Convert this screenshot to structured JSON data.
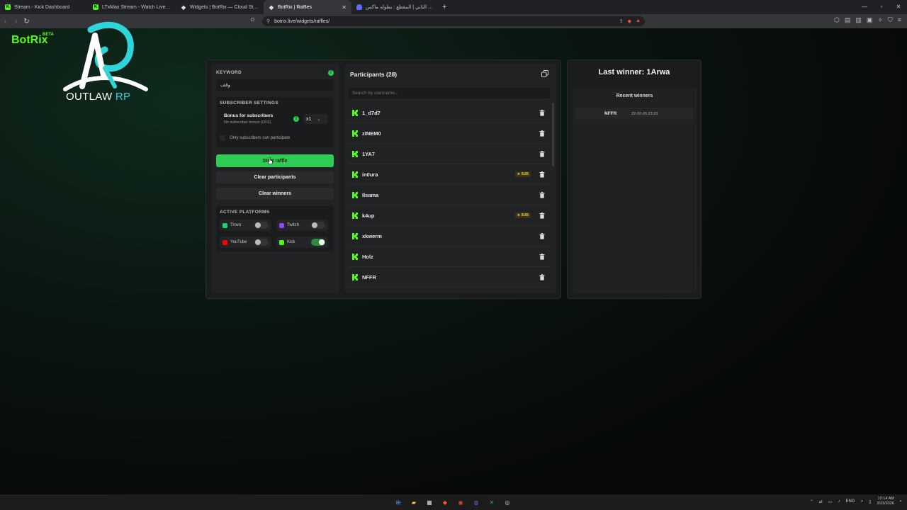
{
  "browser": {
    "tabs": [
      {
        "title": "Stream - Kick Dashboard",
        "icon": "kick-icon"
      },
      {
        "title": "LTxMax Stream - Watch Live on Ki",
        "icon": "kick-icon"
      },
      {
        "title": "Widgets | BotRix — Cloud Streaming",
        "icon": "diamond-icon"
      },
      {
        "title": "BotRix | Raffles",
        "icon": "diamond-icon",
        "active": true
      },
      {
        "title": "الاسبوع الثاني | المقطع : بطوله ماكس",
        "icon": "shield-icon"
      }
    ],
    "url": "botrix.live/widgets/raffles/"
  },
  "brand": {
    "name": "BotRix",
    "badge": "BETA"
  },
  "logo": {
    "text_main": "OUTLAW",
    "text_accent": "RP"
  },
  "raffle": {
    "keyword_label": "KEYWORD",
    "keyword_value": "وقف",
    "subscriber_settings_label": "SUBSCRIBER SETTINGS",
    "bonus_title": "Bonus for subscribers",
    "bonus_subtitle": "No subscriber bonus (OFF)",
    "multiplier": "x1",
    "subs_only_label": "Only subscribers can participate",
    "start_button": "Start raffle",
    "clear_participants_button": "Clear participants",
    "clear_winners_button": "Clear winners",
    "active_platforms_label": "ACTIVE PLATFORMS",
    "platforms": [
      {
        "name": "Trovo",
        "enabled": false
      },
      {
        "name": "Twitch",
        "enabled": false
      },
      {
        "name": "YouTube",
        "enabled": false
      },
      {
        "name": "Kick",
        "enabled": true
      }
    ]
  },
  "participants": {
    "title": "Participants (28)",
    "search_placeholder": "Search by username...",
    "rows": [
      {
        "name": "1_d7d7",
        "sub": false
      },
      {
        "name": "zINEM0",
        "sub": false
      },
      {
        "name": "1YA7",
        "sub": false
      },
      {
        "name": "in0ura",
        "sub": true
      },
      {
        "name": "Ilsama",
        "sub": false
      },
      {
        "name": "k4up",
        "sub": true
      },
      {
        "name": "xkwerm",
        "sub": false
      },
      {
        "name": "Holz",
        "sub": false
      },
      {
        "name": "NFFR",
        "sub": false
      }
    ],
    "sub_badge": "SUB"
  },
  "winners": {
    "last_winner": "Last winner: 1Arwa",
    "recent_title": "Recent winners",
    "recent": [
      {
        "name": "NFFR",
        "date": "22-02-26 23:23"
      }
    ]
  },
  "taskbar": {
    "lang": "ENG",
    "time": "12:14 AM",
    "date": "2/23/2026"
  },
  "colors": {
    "accent": "#53fc18",
    "button_green": "#2ecc55",
    "logo_cyan": "#2fd4d8",
    "sub_badge": "#e0c43a"
  }
}
